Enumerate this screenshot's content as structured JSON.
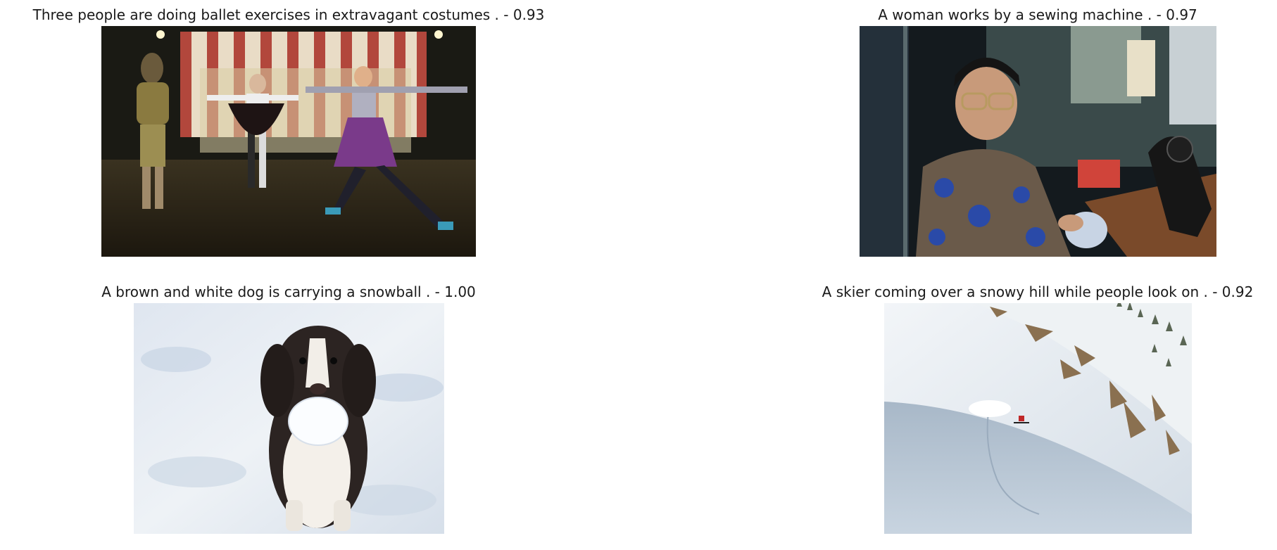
{
  "figure": {
    "panels": [
      {
        "caption": "Three people are doing ballet exercises in extravagant costumes . - 0.93",
        "image_subject": "ballet-dancers-stage-photo"
      },
      {
        "caption": "A woman works by a sewing machine . - 0.97",
        "image_subject": "woman-sewing-machine-photo"
      },
      {
        "caption": "A brown and white dog is carrying a snowball . - 1.00",
        "image_subject": "dog-with-snowball-photo"
      },
      {
        "caption": "A skier coming over a snowy hill while people look on . - 0.92",
        "image_subject": "skier-snowy-hill-photo"
      }
    ]
  }
}
